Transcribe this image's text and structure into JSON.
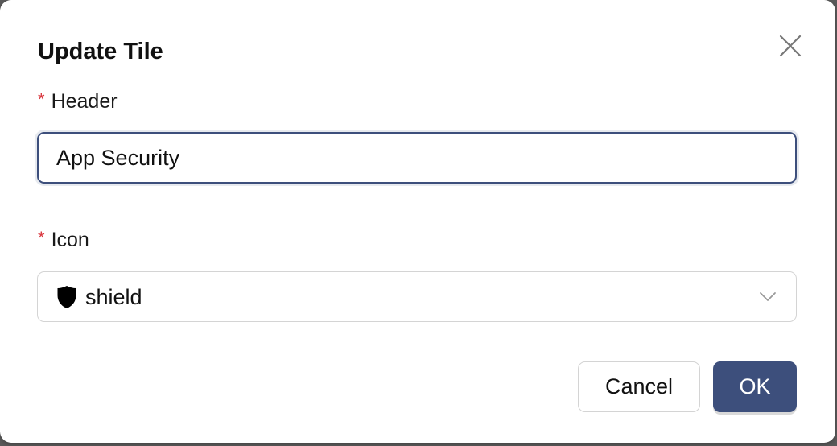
{
  "dialog": {
    "title": "Update Tile",
    "close_icon": "close-icon",
    "required_marker": "*",
    "header_field": {
      "label": "Header",
      "value": "App Security"
    },
    "icon_field": {
      "label": "Icon",
      "selected_value": "shield",
      "selected_icon": "shield-icon",
      "dropdown_icon": "chevron-down-icon"
    },
    "buttons": {
      "cancel_label": "Cancel",
      "ok_label": "OK"
    }
  },
  "colors": {
    "primary": "#3d4f7c",
    "required": "#d9363e",
    "border": "#d4d4d4"
  }
}
